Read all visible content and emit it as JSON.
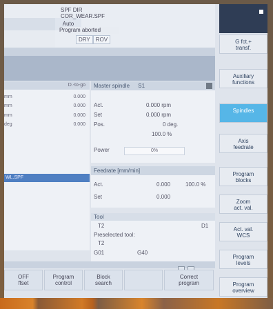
{
  "header": {
    "program_line1": "SPF DIR",
    "program_line2": "COR_WEAR.SPF",
    "mode": "Auto",
    "status": "Program aborted",
    "flags": [
      "DRY",
      "ROV"
    ]
  },
  "axes_panel": {
    "column_header": "D.-to-go",
    "rows": [
      {
        "unit": "mm",
        "value": "0.000"
      },
      {
        "unit": "mm",
        "value": "0.000"
      },
      {
        "unit": "mm",
        "value": "0.000"
      },
      {
        "unit": "deg",
        "value": "0.000"
      }
    ],
    "program_name": "WL.SPF"
  },
  "spindle": {
    "title": "Master spindle",
    "spindle_id": "S1",
    "act_label": "Act.",
    "act_value": "0.000 rpm",
    "set_label": "Set",
    "set_value": "0.000 rpm",
    "pos_label": "Pos.",
    "pos_value": "0 deg.",
    "override": "100.0 %",
    "power_label": "Power",
    "power_value": "0%"
  },
  "feedrate": {
    "title": "Feedrate [mm/min]",
    "act_label": "Act.",
    "act_value": "0.000",
    "act_percent": "100.0 %",
    "set_label": "Set",
    "set_value": "0.000"
  },
  "tool": {
    "title": "Tool",
    "tool_name": "T2",
    "tool_d": "D1",
    "preselected_label": "Preselected tool:",
    "preselected_tool": "T2",
    "g01": "G01",
    "g40": "G40"
  },
  "bottom_softkeys": [
    {
      "label": "OFF\nffset"
    },
    {
      "label": "Program\ncontrol"
    },
    {
      "label": "Block\nsearch"
    },
    {
      "label": ""
    },
    {
      "label": "Correct\nprogram"
    }
  ],
  "right_softkeys": [
    {
      "label": "G fct.+\ntransf."
    },
    {
      "label": "Auxiliary\nfunctions"
    },
    {
      "label": "Spindles"
    },
    {
      "label": "Axis\nfeedrate"
    },
    {
      "label": "Program\nblocks"
    },
    {
      "label": "Zoom\nact. val."
    },
    {
      "label": "Act. val.\nWCS"
    },
    {
      "label": "Program\nlevels"
    },
    {
      "label": "Program\noverview"
    }
  ],
  "colors": {
    "accent": "#56b6e7",
    "panel_bg": "#eef1f6",
    "header_bg": "#cdd6e2",
    "blue_selection": "#4f7fc2"
  }
}
